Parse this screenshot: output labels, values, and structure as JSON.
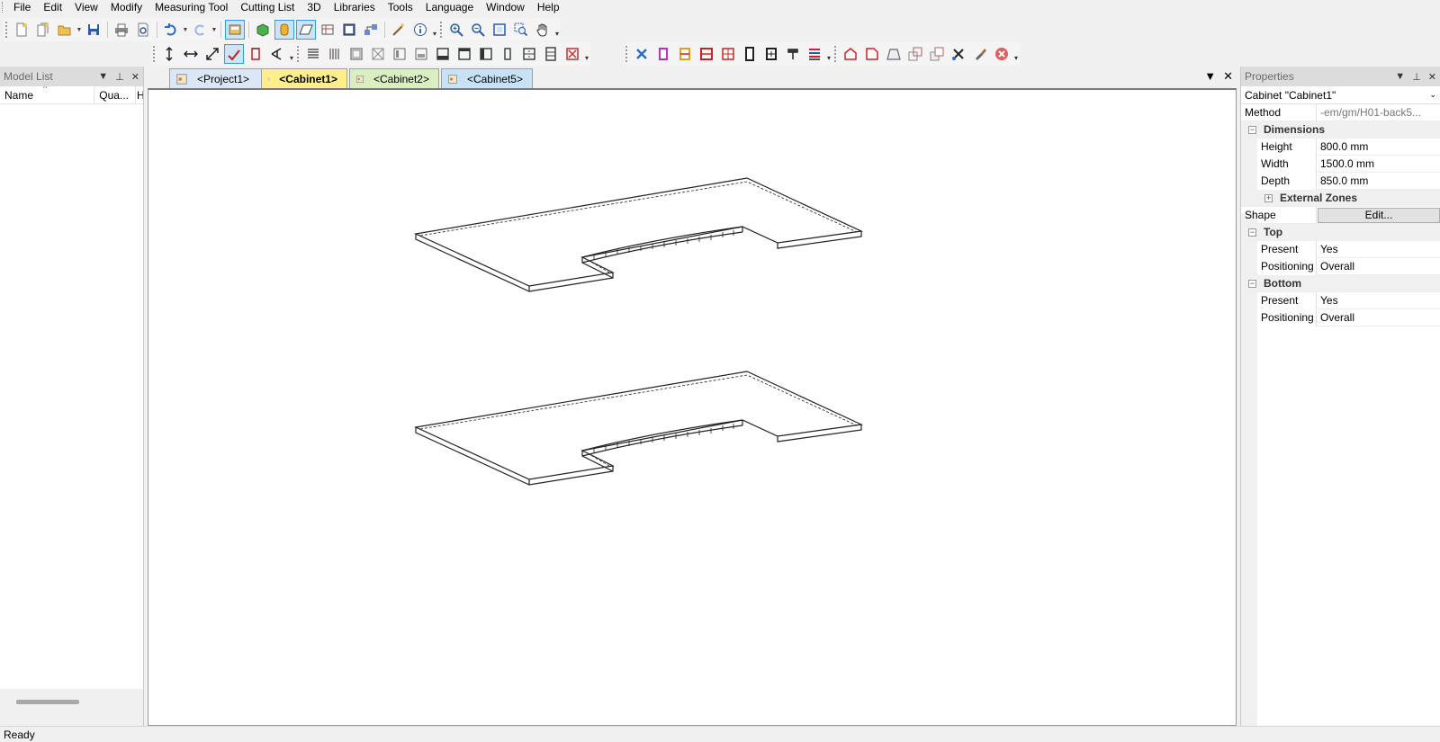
{
  "menu": [
    "File",
    "Edit",
    "View",
    "Modify",
    "Measuring Tool",
    "Cutting List",
    "3D",
    "Libraries",
    "Tools",
    "Language",
    "Window",
    "Help"
  ],
  "model_list": {
    "title": "Model List",
    "columns": [
      "Name",
      "Qua...",
      "H"
    ]
  },
  "tabs": [
    {
      "label": "<Project1>",
      "color": "#dbe6f6",
      "active": false
    },
    {
      "label": "<Cabinet1>",
      "color": "#ffef8a",
      "active": true
    },
    {
      "label": "<Cabinet2>",
      "color": "#d9efc2",
      "active": false
    },
    {
      "label": "<Cabinet5>",
      "color": "#c7e2f7",
      "active": false
    }
  ],
  "properties": {
    "title": "Properties",
    "selected_object": "Cabinet \"Cabinet1\"",
    "method_label": "Method",
    "method_value": "-em/gm/H01-back5...",
    "dimensions_label": "Dimensions",
    "height_label": "Height",
    "height_value": "800.0 mm",
    "width_label": "Width",
    "width_value": "1500.0 mm",
    "depth_label": "Depth",
    "depth_value": "850.0 mm",
    "external_zones_label": "External Zones",
    "shape_label": "Shape",
    "shape_button": "Edit...",
    "top_label": "Top",
    "top_present_label": "Present",
    "top_present_value": "Yes",
    "top_positioning_label": "Positioning",
    "top_positioning_value": "Overall",
    "bottom_label": "Bottom",
    "bottom_present_label": "Present",
    "bottom_present_value": "Yes",
    "bottom_positioning_label": "Positioning",
    "bottom_positioning_value": "Overall"
  },
  "status": "Ready",
  "colors": {
    "selection": "#3399ff",
    "panel_header": "#dcdcdc",
    "close_red": "#e06060"
  }
}
